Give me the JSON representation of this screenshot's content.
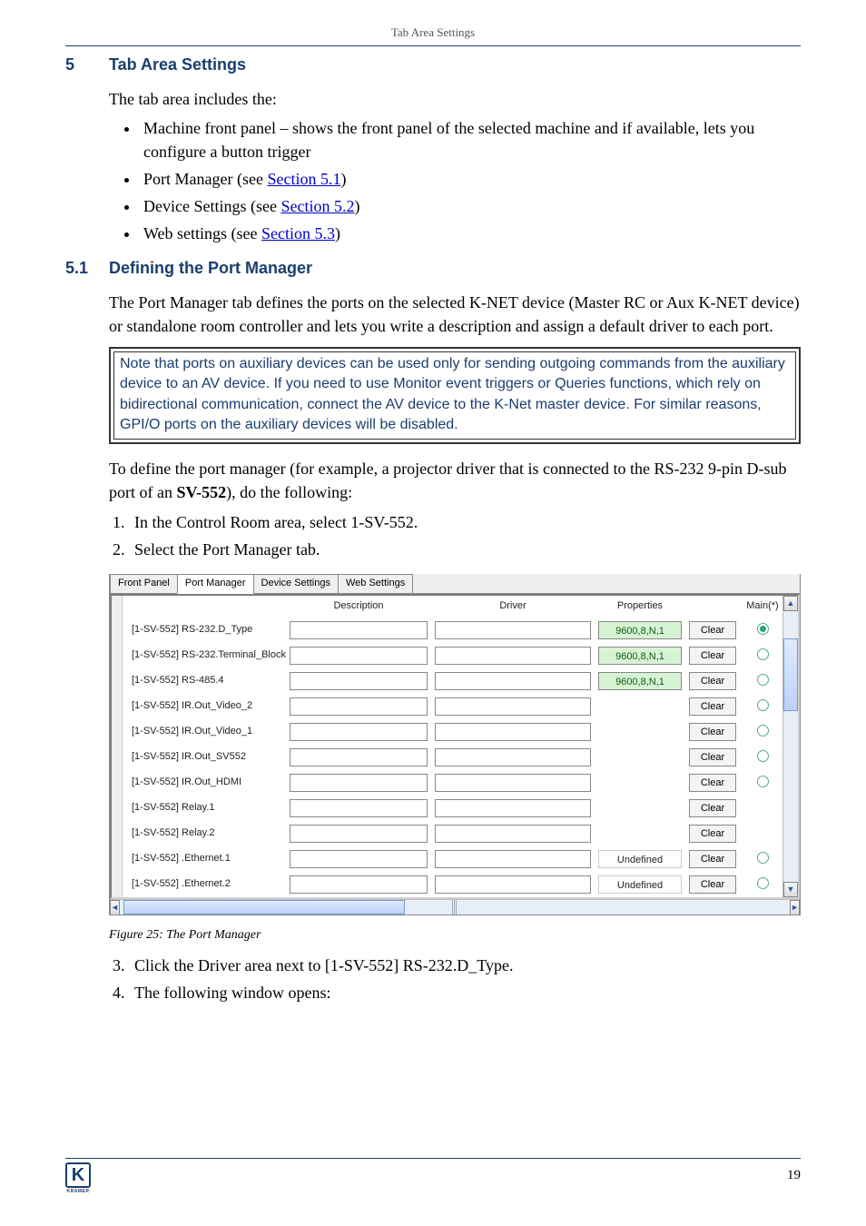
{
  "header": "Tab Area Settings",
  "section5": {
    "num": "5",
    "title": "Tab Area Settings"
  },
  "intro": "The tab area includes the:",
  "bullets": {
    "b0": "Machine front panel – shows the front panel of the selected machine and if available, lets you configure a button trigger",
    "b1_pre": "Port Manager (see ",
    "b1_link": "Section 5.1",
    "b1_post": ")",
    "b2_pre": "Device Settings (see ",
    "b2_link": "Section 5.2",
    "b2_post": ")",
    "b3_pre": "Web settings (see ",
    "b3_link": "Section 5.3",
    "b3_post": ")"
  },
  "section51": {
    "num": "5.1",
    "title": "Defining the Port Manager"
  },
  "p51a": "The Port Manager tab defines the ports on the selected K-NET device (Master RC or Aux K-NET device) or standalone room controller and lets you write a description and assign a default driver to each port.",
  "note": "Note that ports on auxiliary devices can be used only for sending outgoing commands from the auxiliary device to an AV device. If you need to use Monitor event triggers or Queries functions, which rely on bidirectional communication, connect the AV device to the K-Net master device. For similar reasons, GPI/O ports on the auxiliary devices will be disabled.",
  "p51b_pre": "To define the port manager (for example, a projector driver that is connected to the RS-232 9-pin D-sub port of an ",
  "p51b_bold": "SV-552",
  "p51b_post": "), do the following:",
  "steps1": {
    "s1": "In the Control Room area, select 1-SV-552.",
    "s2": "Select the Port Manager tab."
  },
  "shot": {
    "tabs": {
      "t0": "Front Panel",
      "t1": "Port Manager",
      "t2": "Device Settings",
      "t3": "Web Settings"
    },
    "hdr": {
      "h1": "Description",
      "h2": "Driver",
      "h3": "Properties",
      "h4": "Main(*)"
    },
    "clear": "Clear",
    "rows": [
      {
        "name": "[1-SV-552] RS-232.D_Type",
        "props": "9600,8,N,1",
        "propsType": "link",
        "main": "sel"
      },
      {
        "name": "[1-SV-552] RS-232.Terminal_Block",
        "props": "9600,8,N,1",
        "propsType": "link",
        "main": "ring"
      },
      {
        "name": "[1-SV-552] RS-485.4",
        "props": "9600,8,N,1",
        "propsType": "link",
        "main": "ring"
      },
      {
        "name": "[1-SV-552] IR.Out_Video_2",
        "props": "",
        "propsType": "",
        "main": "ring"
      },
      {
        "name": "[1-SV-552] IR.Out_Video_1",
        "props": "",
        "propsType": "",
        "main": "ring"
      },
      {
        "name": "[1-SV-552] IR.Out_SV552",
        "props": "",
        "propsType": "",
        "main": "ring"
      },
      {
        "name": "[1-SV-552] IR.Out_HDMI",
        "props": "",
        "propsType": "",
        "main": "ring"
      },
      {
        "name": "[1-SV-552] Relay.1",
        "props": "",
        "propsType": "",
        "main": ""
      },
      {
        "name": "[1-SV-552] Relay.2",
        "props": "",
        "propsType": "",
        "main": ""
      },
      {
        "name": "[1-SV-552] .Ethernet.1",
        "props": "Undefined",
        "propsType": "undef",
        "main": "ring"
      },
      {
        "name": "[1-SV-552] .Ethernet.2",
        "props": "Undefined",
        "propsType": "undef",
        "main": "ring"
      }
    ]
  },
  "figcap": "Figure 25: The Port Manager",
  "steps2": {
    "s3": "Click the Driver area next to [1-SV-552] RS-232.D_Type.",
    "s4": "The following window opens:"
  },
  "pagenum": "19",
  "logo": "K",
  "logo_sub": "KRAMER"
}
